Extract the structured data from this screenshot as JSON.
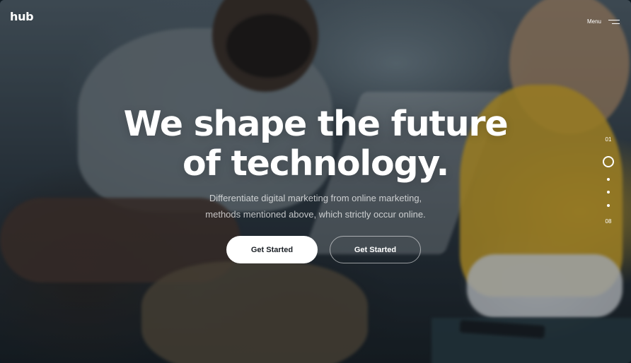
{
  "header": {
    "logo": "hub",
    "menu_label": "Menu"
  },
  "hero": {
    "headline_line1": "We shape the future",
    "headline_line2": "of technology.",
    "subtext_line1": "Differentiate digital marketing from online marketing,",
    "subtext_line2": "methods mentioned above, which strictly occur online.",
    "primary_button": "Get Started",
    "secondary_button": "Get Started"
  },
  "pager": {
    "current": "01",
    "total": "08",
    "active_index": 1
  },
  "colors": {
    "accent_sweater": "#d6aa28",
    "button_bg": "#ffffff",
    "button_text": "#1a1f25"
  },
  "icons": {
    "menu": "hamburger-icon",
    "pager_active": "ring-icon",
    "pager_inactive": "dot-icon"
  }
}
